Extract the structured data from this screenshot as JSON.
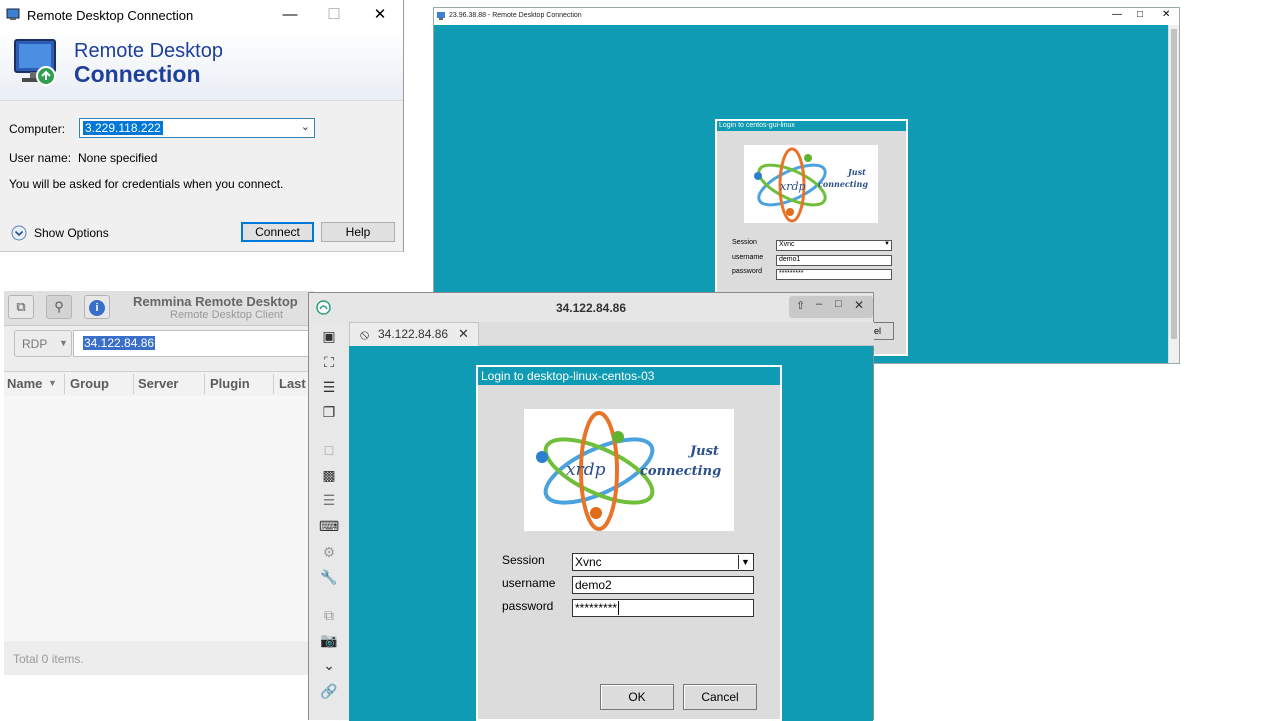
{
  "rdc": {
    "title": "Remote Desktop Connection",
    "banner_line1": "Remote Desktop",
    "banner_line2": "Connection",
    "computer_label": "Computer:",
    "computer_value": "3.229.118.222",
    "username_label": "User name:",
    "username_value": "None specified",
    "credentials_note": "You will be asked for credentials when you connect.",
    "show_options": "Show Options",
    "connect_button": "Connect",
    "help_button": "Help"
  },
  "remote_window": {
    "title": "23.96.38.88 - Remote Desktop Connection",
    "login_title": "Login to centos-gui-linux",
    "session_label": "Session",
    "session_value": "Xvnc",
    "username_label": "username",
    "username_value": "demo1",
    "password_label": "password",
    "password_value": "*********",
    "cancel_fragment": "el"
  },
  "remmina": {
    "title": "Remmina Remote Desktop",
    "subtitle": "Remote Desktop Client",
    "protocol": "RDP",
    "address": "34.122.84.86",
    "columns": [
      "Name",
      "Group",
      "Server",
      "Plugin",
      "Last"
    ],
    "footer": "Total 0 items."
  },
  "connection": {
    "title": "34.122.84.86",
    "tab_label": "34.122.84.86",
    "login_title": "Login to desktop-linux-centos-03",
    "logo_text_xrdp": "xrdp",
    "logo_text_just": "Just",
    "logo_text_connecting": "connecting",
    "session_label": "Session",
    "session_value": "Xvnc",
    "username_label": "username",
    "username_value": "demo2",
    "password_label": "password",
    "password_value": "*********",
    "ok_button": "OK",
    "cancel_button": "Cancel"
  },
  "colors": {
    "teal_desktop": "#0f9bb3",
    "win_blue": "#1e3f9a",
    "selection": "#0078d7"
  }
}
